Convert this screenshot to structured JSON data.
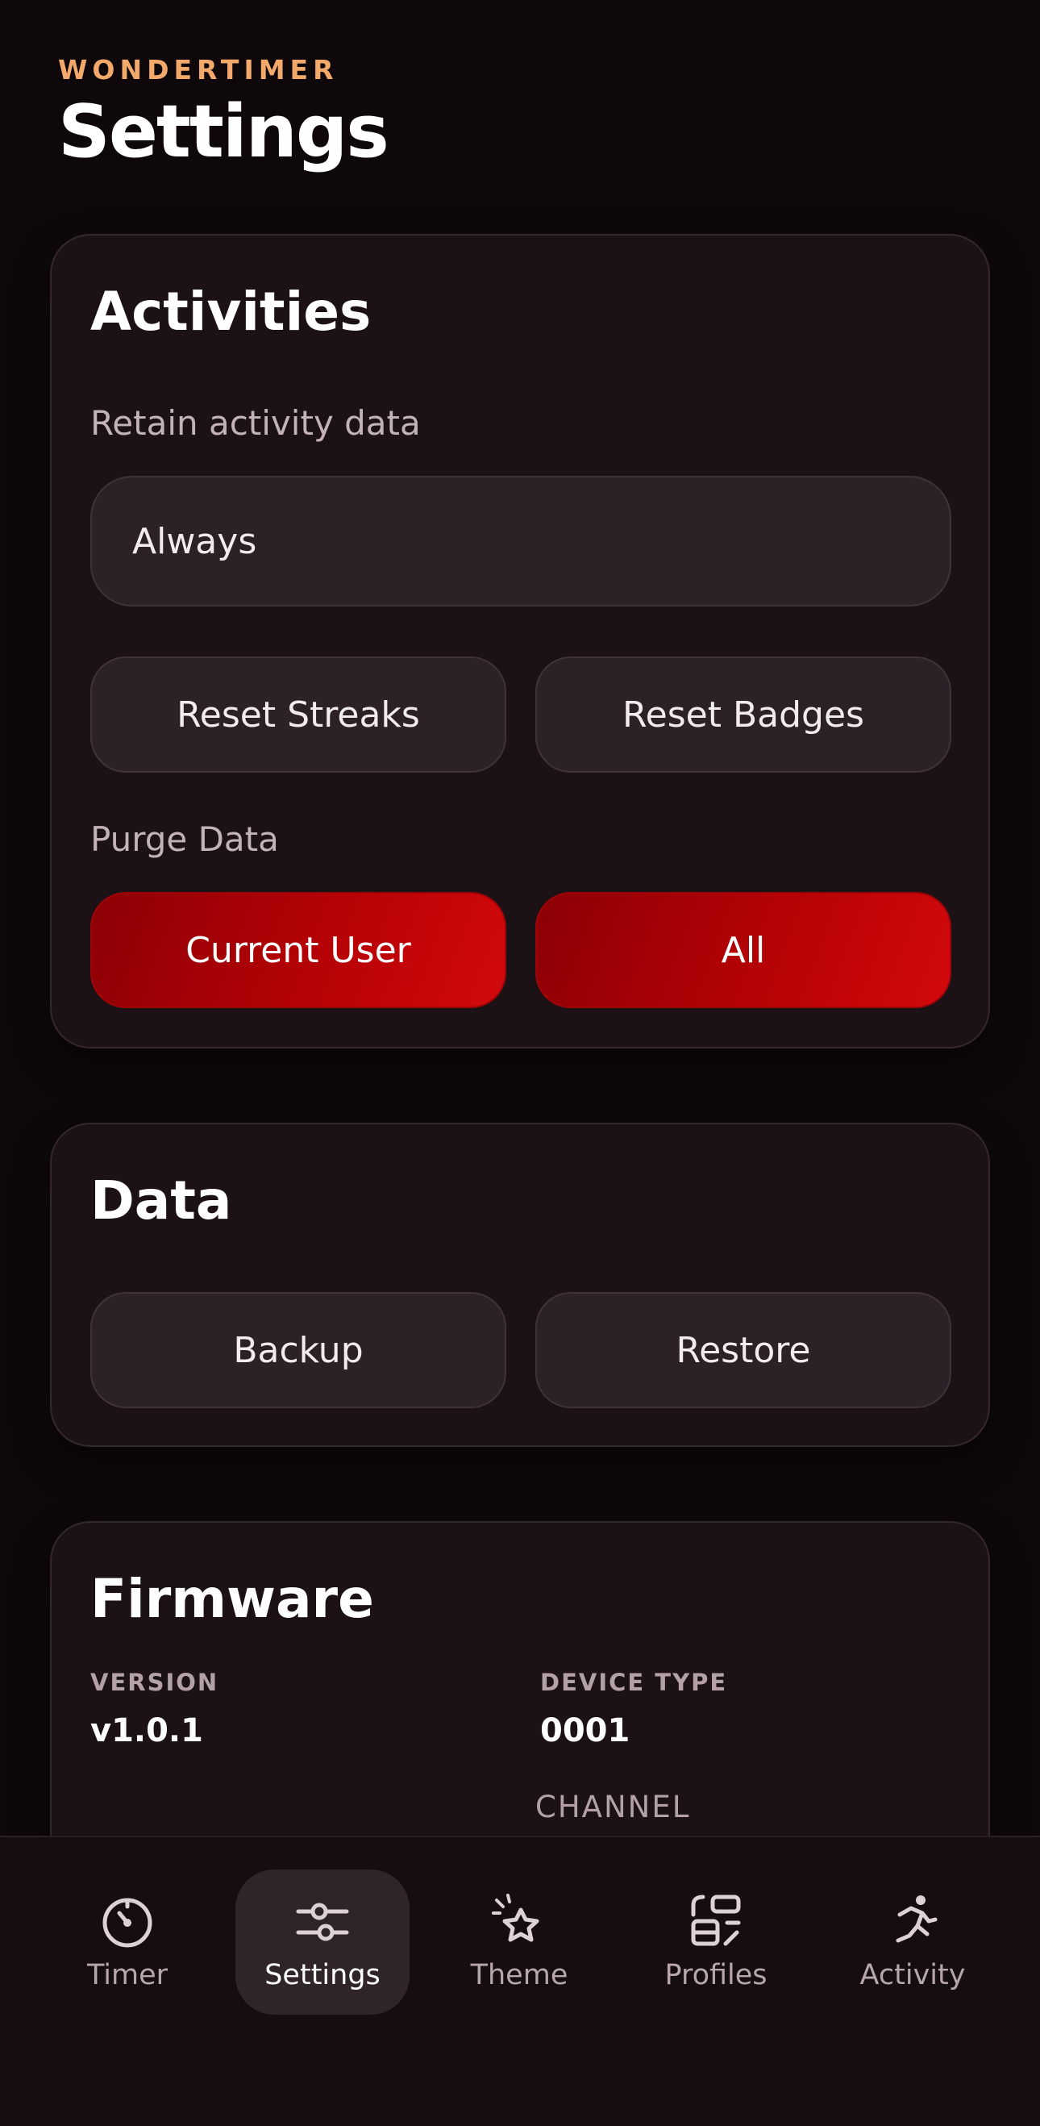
{
  "header": {
    "brand": "WONDERTIMER",
    "title": "Settings"
  },
  "activities": {
    "title": "Activities",
    "retain_label": "Retain activity data",
    "retain_value": "Always",
    "reset_streaks": "Reset Streaks",
    "reset_badges": "Reset Badges",
    "purge_label": "Purge Data",
    "purge_current_user": "Current User",
    "purge_all": "All"
  },
  "data_section": {
    "title": "Data",
    "backup": "Backup",
    "restore": "Restore"
  },
  "firmware": {
    "title": "Firmware",
    "version_label": "VERSION",
    "version_value": "v1.0.1",
    "device_type_label": "DEVICE TYPE",
    "device_type_value": "0001",
    "channel_label": "CHANNEL"
  },
  "nav": {
    "items": [
      {
        "label": "Timer",
        "icon": "timer-icon",
        "active": false
      },
      {
        "label": "Settings",
        "icon": "sliders-icon",
        "active": true
      },
      {
        "label": "Theme",
        "icon": "sparkle-star-icon",
        "active": false
      },
      {
        "label": "Profiles",
        "icon": "profiles-icon",
        "active": false
      },
      {
        "label": "Activity",
        "icon": "running-person-icon",
        "active": false
      }
    ]
  },
  "colors": {
    "accent": "#f2a96a",
    "danger": "#c00408",
    "background": "#0e080b",
    "card": "#1c1216"
  }
}
